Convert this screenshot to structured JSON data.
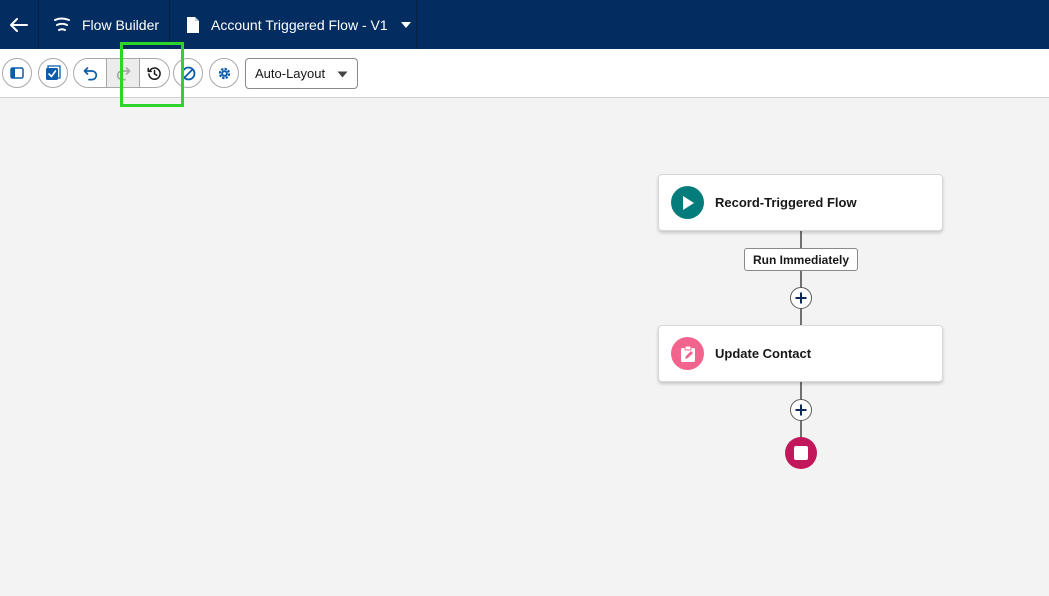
{
  "header": {
    "app_title": "Flow Builder",
    "flow_title": "Account Triggered Flow - V1",
    "icons": {
      "back": "arrow-left-icon",
      "app": "flow-builder-icon",
      "file": "document-icon",
      "menu": "chevron-down-icon"
    }
  },
  "toolbar": {
    "buttons": [
      "toggle-panel-icon",
      "check-flow-icon",
      "undo-icon",
      "redo-icon",
      "history-icon",
      "deactivate-icon",
      "settings-icon"
    ],
    "layout_select": {
      "value": "Auto-Layout"
    }
  },
  "canvas": {
    "start_node": {
      "label": "Record-Triggered Flow",
      "icon": "play-icon",
      "color": "#047c7c"
    },
    "path_label": "Run Immediately",
    "action_node": {
      "label": "Update Contact",
      "icon": "clipboard-edit-icon",
      "color": "#f2648e"
    },
    "end_node": {
      "icon": "stop-icon",
      "color": "#c2185b"
    }
  },
  "colors": {
    "header_bg": "#032d60",
    "highlight": "#2fd42b",
    "brand_blue": "#0b5cab"
  }
}
